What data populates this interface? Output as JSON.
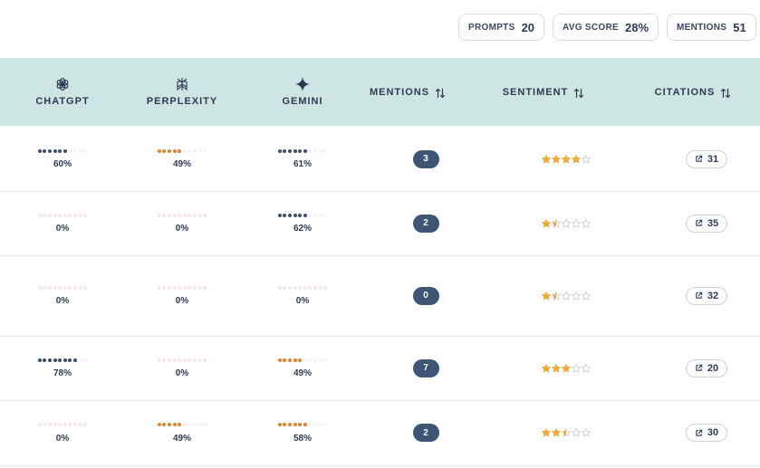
{
  "stats": [
    {
      "label": "PROMPTS",
      "value": "20"
    },
    {
      "label": "AVG SCORE",
      "value": "28%"
    },
    {
      "label": "MENTIONS",
      "value": "51"
    }
  ],
  "columns": {
    "chatgpt": {
      "label": "CHATGPT",
      "icon": "chatgpt-icon"
    },
    "perplexity": {
      "label": "PERPLEXITY",
      "icon": "perplexity-icon"
    },
    "gemini": {
      "label": "GEMINI",
      "icon": "gemini-icon"
    },
    "mentions": {
      "label": "MENTIONS",
      "icon": "sort-icon"
    },
    "sentiment": {
      "label": "SENTIMENT",
      "icon": "sort-icon"
    },
    "citations": {
      "label": "CITATIONS",
      "icon": "sort-icon"
    }
  },
  "colors": {
    "orange": "#e5822b",
    "navy": "#3b4e70",
    "faint": "#f3e7ee",
    "star": "#f0a936",
    "star_empty": "#c5cad3",
    "header_bg": "#cde5e3",
    "badge_bg": "#3e5576"
  },
  "rows": [
    {
      "chatgpt": "60%",
      "perplexity": "49%",
      "gemini": "61%",
      "mentions": "3",
      "sentiment": 4,
      "citations": "31"
    },
    {
      "chatgpt": "0%",
      "perplexity": "0%",
      "gemini": "62%",
      "mentions": "2",
      "sentiment": 1.5,
      "citations": "35"
    },
    {
      "chatgpt": "0%",
      "perplexity": "0%",
      "gemini": "0%",
      "mentions": "0",
      "sentiment": 1.5,
      "citations": "32"
    },
    {
      "chatgpt": "78%",
      "perplexity": "0%",
      "gemini": "49%",
      "mentions": "7",
      "sentiment": 3,
      "citations": "20"
    },
    {
      "chatgpt": "0%",
      "perplexity": "49%",
      "gemini": "58%",
      "mentions": "2",
      "sentiment": 2.5,
      "citations": "30"
    }
  ]
}
